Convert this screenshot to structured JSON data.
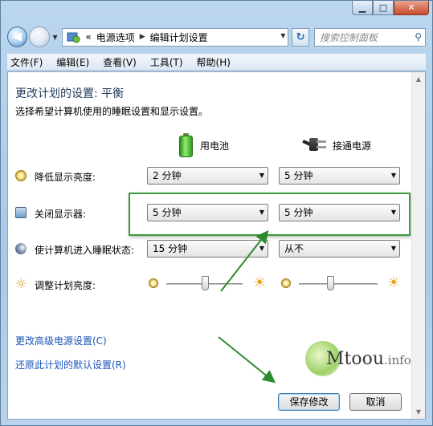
{
  "window": {
    "minimize": "▁",
    "maximize": "□",
    "close": "✕"
  },
  "nav": {
    "back_icon": "back-arrow-icon",
    "forward_icon": "forward-arrow-icon",
    "breadcrumb_prefix": "«",
    "breadcrumb": [
      "电源选项",
      "编辑计划设置"
    ],
    "search_placeholder": "搜索控制面板"
  },
  "menu": [
    "文件(F)",
    "编辑(E)",
    "查看(V)",
    "工具(T)",
    "帮助(H)"
  ],
  "plan": {
    "title": "更改计划的设置: 平衡",
    "description": "选择希望计算机使用的睡眠设置和显示设置。"
  },
  "columns": {
    "battery": "用电池",
    "plugged": "接通电源"
  },
  "settings": [
    {
      "label": "降低显示亮度:",
      "battery": "2 分钟",
      "plugged": "5 分钟",
      "icon": "dim-display-icon"
    },
    {
      "label": "关闭显示器:",
      "battery": "5 分钟",
      "plugged": "5 分钟",
      "icon": "monitor-clock-icon"
    },
    {
      "label": "使计算机进入睡眠状态:",
      "battery": "15 分钟",
      "plugged": "从不",
      "icon": "moon-sleep-icon"
    }
  ],
  "brightness": {
    "label": "调整计划亮度:",
    "battery_level": 0.5,
    "plugged_level": 0.4
  },
  "links": {
    "advanced": "更改高级电源设置(C)",
    "restore": "还原此计划的默认设置(R)"
  },
  "buttons": {
    "save": "保存修改",
    "cancel": "取消"
  },
  "watermark": {
    "main": "Mtoou",
    "suffix": ".info"
  },
  "colors": {
    "accent_title": "#1e395b",
    "link": "#1a55b8",
    "highlight": "#3a9a3a"
  }
}
